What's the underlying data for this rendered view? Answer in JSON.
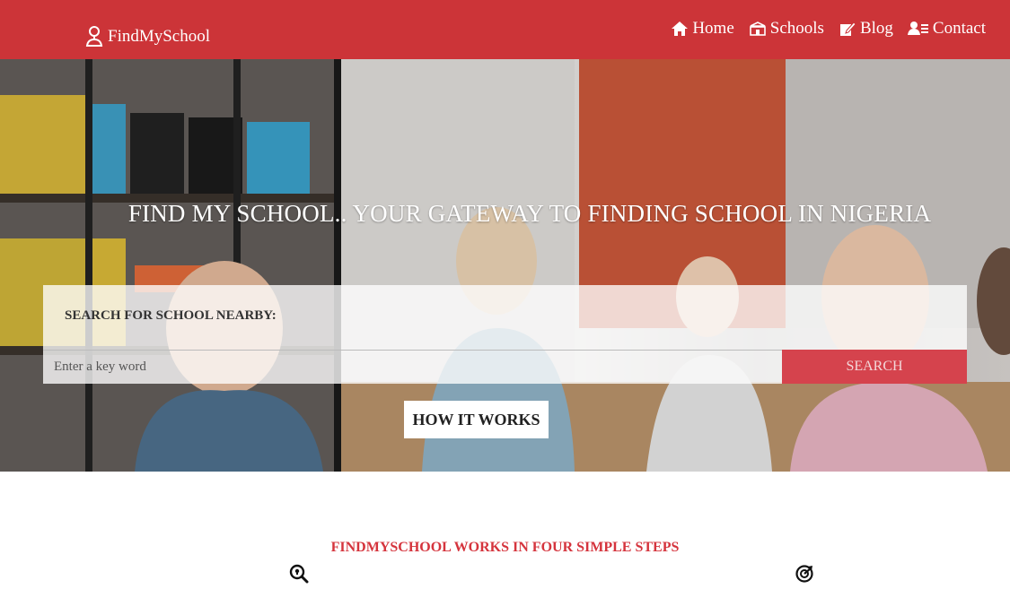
{
  "brand": {
    "name": "FindMySchool",
    "icon": "user-pin-icon"
  },
  "nav": {
    "items": [
      {
        "label": "Home",
        "icon": "home-icon"
      },
      {
        "label": "Schools",
        "icon": "school-icon"
      },
      {
        "label": "Blog",
        "icon": "edit-icon"
      },
      {
        "label": "Contact",
        "icon": "contact-card-icon"
      }
    ]
  },
  "hero": {
    "title": "FIND MY SCHOOL.. YOUR GATEWAY TO FINDING SCHOOL IN NIGERIA",
    "search_label": "SEARCH FOR SCHOOL NEARBY:",
    "search_placeholder": "Enter a key word",
    "search_button": "SEARCH",
    "how_button": "HOW IT WORKS"
  },
  "steps": {
    "title": "FINDMYSCHOOL WORKS IN FOUR SIMPLE STEPS",
    "icons": [
      "search-location-icon",
      "radar-icon"
    ]
  },
  "colors": {
    "brand_red": "#cc3438",
    "button_red": "#d5434d",
    "heading_red": "#d5343d"
  }
}
